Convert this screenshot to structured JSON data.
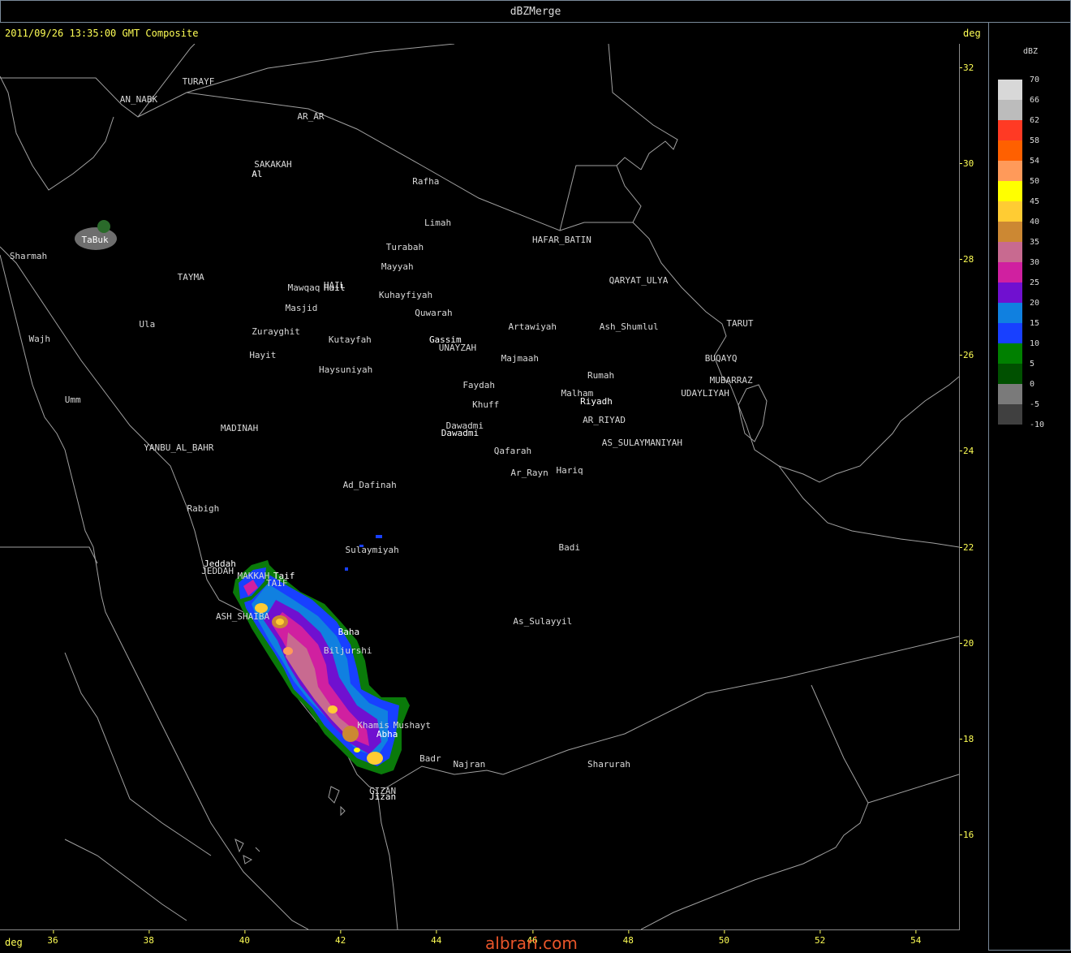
{
  "window": {
    "title": "dBZMerge"
  },
  "header": {
    "timestamp": "2011/09/26 13:35:00 GMT Composite",
    "unit": "deg"
  },
  "footer": {
    "unit": "deg",
    "watermark": "albrari.com"
  },
  "axes": {
    "lat_labels": [
      "32",
      "30",
      "28",
      "26",
      "24",
      "22",
      "20",
      "18",
      "16"
    ],
    "lon_labels": [
      "36",
      "38",
      "40",
      "42",
      "44",
      "46",
      "48",
      "50",
      "52",
      "54"
    ]
  },
  "legend": {
    "unit": "dBZ",
    "entries": [
      {
        "label": "70",
        "color": "#d8d8d8"
      },
      {
        "label": "66",
        "color": "#bcbcbc"
      },
      {
        "label": "62",
        "color": "#ff3a24"
      },
      {
        "label": "58",
        "color": "#ff6000"
      },
      {
        "label": "54",
        "color": "#ff9a5a"
      },
      {
        "label": "50",
        "color": "#ffff00"
      },
      {
        "label": "45",
        "color": "#ffcc33"
      },
      {
        "label": "40",
        "color": "#cc8833"
      },
      {
        "label": "35",
        "color": "#c86a90"
      },
      {
        "label": "30",
        "color": "#d020a0"
      },
      {
        "label": "25",
        "color": "#7010d0"
      },
      {
        "label": "20",
        "color": "#1080e0"
      },
      {
        "label": "15",
        "color": "#1840ff"
      },
      {
        "label": "10",
        "color": "#008000"
      },
      {
        "label": "5",
        "color": "#005000"
      },
      {
        "label": "0",
        "color": "#7a7a7a"
      },
      {
        "label": "-5",
        "color": "#404040"
      },
      {
        "label": "-10",
        "color": ""
      }
    ]
  },
  "cities": [
    {
      "name": "TURAYF",
      "lon": 38.7,
      "lat": 31.7
    },
    {
      "name": "AN_NABK",
      "lon": 37.4,
      "lat": 31.33
    },
    {
      "name": "AR_AR",
      "lon": 41.1,
      "lat": 30.98
    },
    {
      "name": "SAKAKAH",
      "lon": 40.2,
      "lat": 29.98
    },
    {
      "name": "Al",
      "lon": 40.15,
      "lat": 29.78,
      "bright": true
    },
    {
      "name": "Rafha",
      "lon": 43.5,
      "lat": 29.63
    },
    {
      "name": "Limah",
      "lon": 43.75,
      "lat": 28.76
    },
    {
      "name": "HAFAR_BATIN",
      "lon": 46.0,
      "lat": 28.4
    },
    {
      "name": "Turabah",
      "lon": 42.95,
      "lat": 28.26
    },
    {
      "name": "TaBuk",
      "lon": 36.6,
      "lat": 28.4,
      "bright": true
    },
    {
      "name": "Sharmah",
      "lon": 35.1,
      "lat": 28.07
    },
    {
      "name": "Mayyah",
      "lon": 42.85,
      "lat": 27.85
    },
    {
      "name": "TAYMA",
      "lon": 38.6,
      "lat": 27.63
    },
    {
      "name": "QARYAT_ULYA",
      "lon": 47.6,
      "lat": 27.56
    },
    {
      "name": "Mawqaq",
      "lon": 40.9,
      "lat": 27.4
    },
    {
      "name": "HAIL",
      "lon": 41.65,
      "lat": 27.45
    },
    {
      "name": "Hail",
      "lon": 41.65,
      "lat": 27.4,
      "bright": true
    },
    {
      "name": "Kuhayfiyah",
      "lon": 42.8,
      "lat": 27.25
    },
    {
      "name": "Masjid",
      "lon": 40.85,
      "lat": 26.98
    },
    {
      "name": "Quwarah",
      "lon": 43.55,
      "lat": 26.88
    },
    {
      "name": "Ula",
      "lon": 37.8,
      "lat": 26.65
    },
    {
      "name": "Artawiyah",
      "lon": 45.5,
      "lat": 26.6
    },
    {
      "name": "Ash_Shumlul",
      "lon": 47.4,
      "lat": 26.6
    },
    {
      "name": "TARUT",
      "lon": 50.05,
      "lat": 26.67
    },
    {
      "name": "Zurayghit",
      "lon": 40.15,
      "lat": 26.5
    },
    {
      "name": "Wajh",
      "lon": 35.5,
      "lat": 26.34
    },
    {
      "name": "Kutayfah",
      "lon": 41.75,
      "lat": 26.33
    },
    {
      "name": "Gassim",
      "lon": 43.85,
      "lat": 26.33,
      "bright": true
    },
    {
      "name": "UNAYZAH",
      "lon": 44.05,
      "lat": 26.15
    },
    {
      "name": "Hayit",
      "lon": 40.1,
      "lat": 26.0
    },
    {
      "name": "Majmaah",
      "lon": 45.35,
      "lat": 25.93
    },
    {
      "name": "BUQAYQ",
      "lon": 49.6,
      "lat": 25.93
    },
    {
      "name": "Haysuniyah",
      "lon": 41.55,
      "lat": 25.7
    },
    {
      "name": "Rumah",
      "lon": 47.15,
      "lat": 25.58
    },
    {
      "name": "MUBARRAZ",
      "lon": 49.7,
      "lat": 25.48
    },
    {
      "name": "Faydah",
      "lon": 44.55,
      "lat": 25.38
    },
    {
      "name": "Malham",
      "lon": 46.6,
      "lat": 25.2
    },
    {
      "name": "UDAYLIYAH",
      "lon": 49.1,
      "lat": 25.2
    },
    {
      "name": "Riyadh",
      "lon": 47.0,
      "lat": 25.03,
      "bright": true
    },
    {
      "name": "Umm",
      "lon": 36.25,
      "lat": 25.08
    },
    {
      "name": "Khuff",
      "lon": 44.75,
      "lat": 24.97
    },
    {
      "name": "AR_RIYAD",
      "lon": 47.05,
      "lat": 24.65
    },
    {
      "name": "Dawadmi",
      "lon": 44.2,
      "lat": 24.53
    },
    {
      "name": "Dawadmi",
      "lon": 44.1,
      "lat": 24.37,
      "bright": true
    },
    {
      "name": "MADINAH",
      "lon": 39.5,
      "lat": 24.48
    },
    {
      "name": "AS_SULAYMANIYAH",
      "lon": 47.45,
      "lat": 24.17
    },
    {
      "name": "YANBU_AL_BAHR",
      "lon": 37.9,
      "lat": 24.07
    },
    {
      "name": "Qafarah",
      "lon": 45.2,
      "lat": 24.0
    },
    {
      "name": "Hariq",
      "lon": 46.5,
      "lat": 23.6
    },
    {
      "name": "Ar_Rayn",
      "lon": 45.55,
      "lat": 23.55
    },
    {
      "name": "Ad_Dafinah",
      "lon": 42.05,
      "lat": 23.3
    },
    {
      "name": "Rabigh",
      "lon": 38.8,
      "lat": 22.8
    },
    {
      "name": "Badi",
      "lon": 46.55,
      "lat": 22.0
    },
    {
      "name": "Sulaymiyah",
      "lon": 42.1,
      "lat": 21.95
    },
    {
      "name": "Jeddah",
      "lon": 39.15,
      "lat": 21.65,
      "bright": true
    },
    {
      "name": "JEDDAH",
      "lon": 39.1,
      "lat": 21.5
    },
    {
      "name": "MAKKAH",
      "lon": 39.85,
      "lat": 21.4
    },
    {
      "name": "Taif",
      "lon": 40.6,
      "lat": 21.4,
      "bright": true
    },
    {
      "name": "TAIF",
      "lon": 40.45,
      "lat": 21.25
    },
    {
      "name": "ASH_SHAIBA",
      "lon": 39.4,
      "lat": 20.55
    },
    {
      "name": "Baha",
      "lon": 41.95,
      "lat": 20.23,
      "bright": true
    },
    {
      "name": "As_Sulayyil",
      "lon": 45.6,
      "lat": 20.45
    },
    {
      "name": "Biljurshi",
      "lon": 41.65,
      "lat": 19.85
    },
    {
      "name": "Khamis",
      "lon": 42.35,
      "lat": 18.28
    },
    {
      "name": "Mushayt",
      "lon": 43.1,
      "lat": 18.28
    },
    {
      "name": "Abha",
      "lon": 42.75,
      "lat": 18.1,
      "bright": true
    },
    {
      "name": "Badr",
      "lon": 43.65,
      "lat": 17.6
    },
    {
      "name": "Najran",
      "lon": 44.35,
      "lat": 17.48
    },
    {
      "name": "Sharurah",
      "lon": 47.15,
      "lat": 17.48
    },
    {
      "name": "Jizan",
      "lon": 42.6,
      "lat": 16.8,
      "bright": true
    },
    {
      "name": "GIZAN",
      "lon": 42.6,
      "lat": 16.92
    }
  ]
}
